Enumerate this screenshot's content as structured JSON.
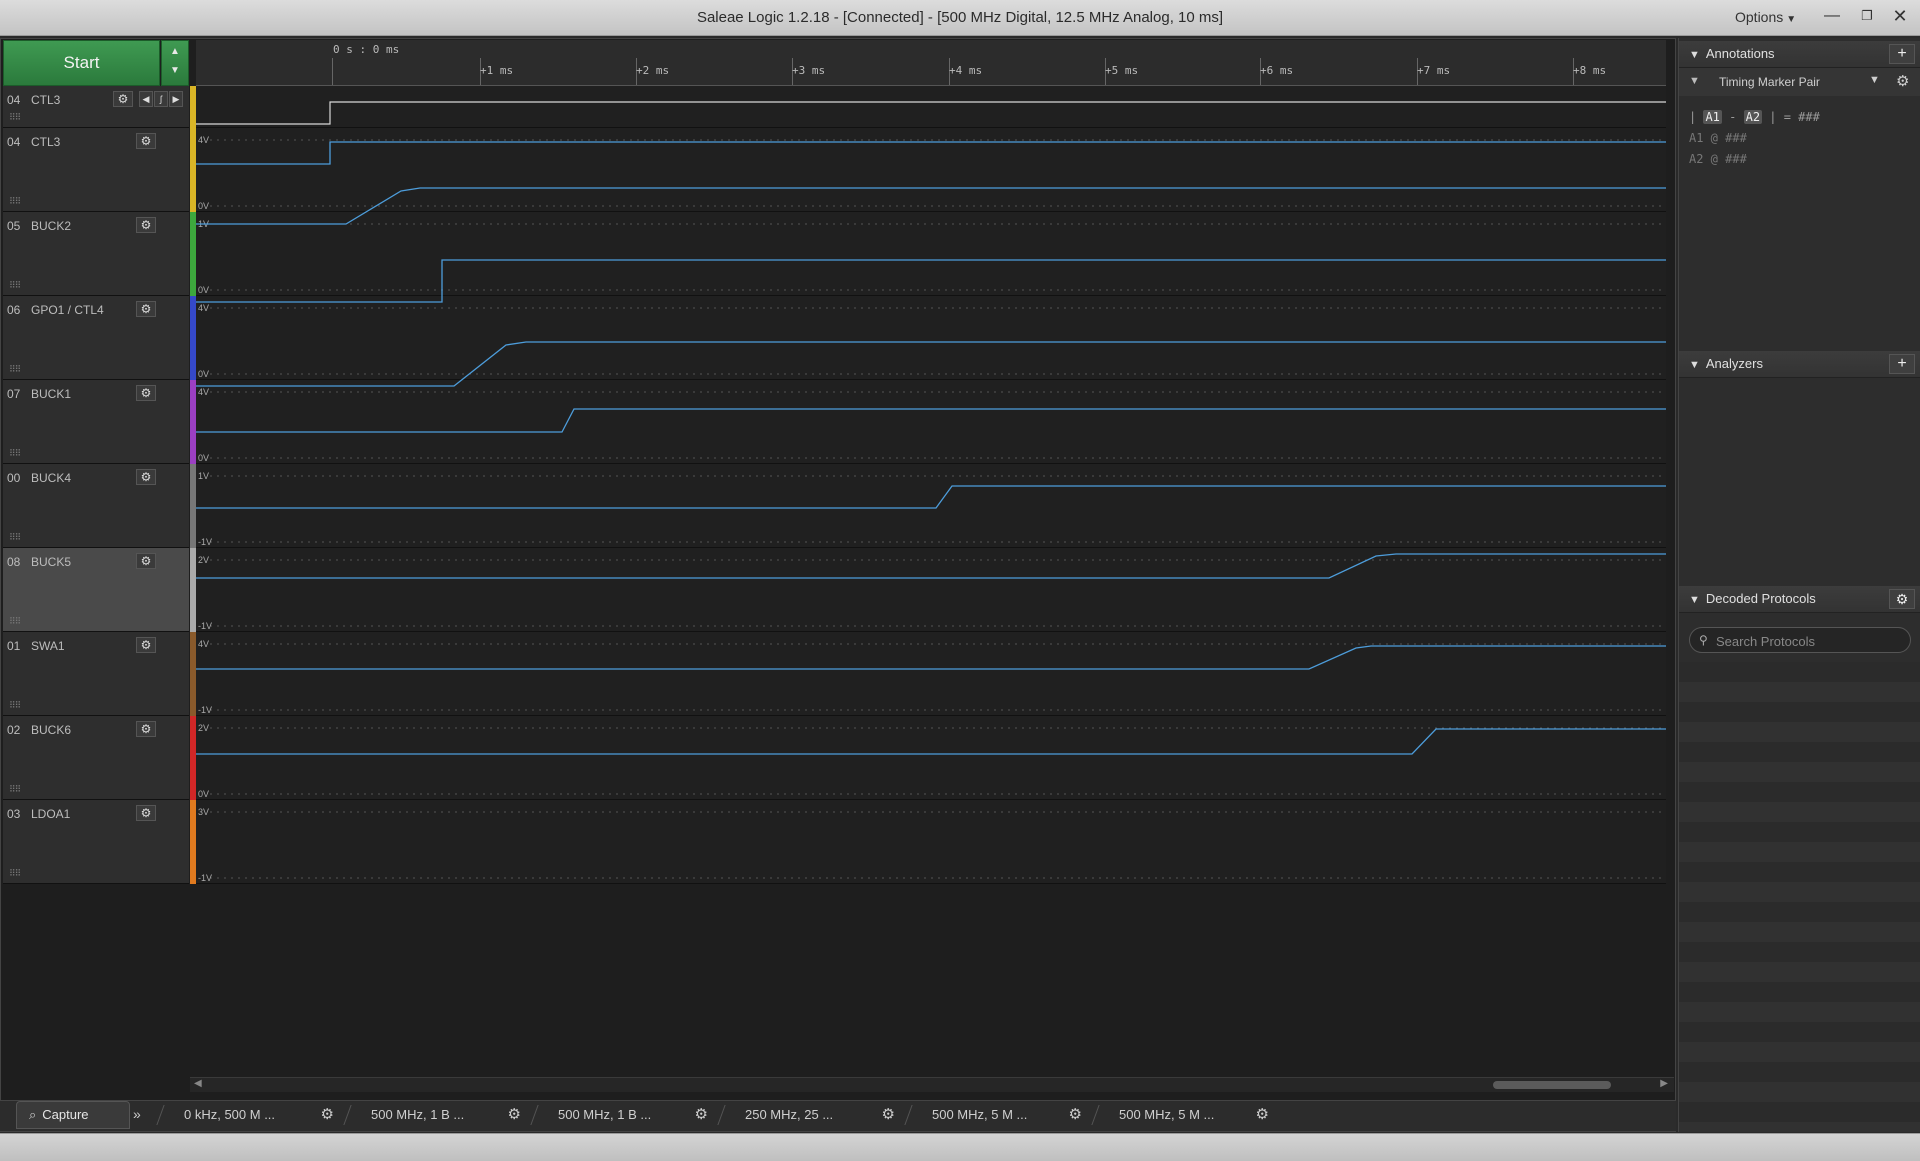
{
  "window": {
    "title": "Saleae Logic 1.2.18 - [Connected] - [500 MHz Digital, 12.5 MHz Analog, 10 ms]",
    "options_label": "Options",
    "minimize": "—",
    "maximize": "❐",
    "close": "✕"
  },
  "toolbar": {
    "start_label": "Start",
    "up_arrow": "▲",
    "down_arrow": "▼"
  },
  "ruler": {
    "origin_label": "0 s : 0 ms",
    "ticks": [
      "+1 ms",
      "+2 ms",
      "+3 ms",
      "+4 ms",
      "+5 ms",
      "+6 ms",
      "+7 ms",
      "+8 ms"
    ]
  },
  "channels": [
    {
      "num": "04",
      "name": "CTL3",
      "color": "#d9b526",
      "kind": "digital"
    },
    {
      "num": "04",
      "name": "CTL3",
      "color": "#d9b526",
      "kind": "analog",
      "vtop": "4V",
      "vbot": "0V"
    },
    {
      "num": "05",
      "name": "BUCK2",
      "color": "#3da83d",
      "kind": "analog",
      "vtop": "1V",
      "vbot": "0V"
    },
    {
      "num": "06",
      "name": "GPO1 / CTL4",
      "color": "#3549c9",
      "kind": "analog",
      "vtop": "4V",
      "vbot": "0V"
    },
    {
      "num": "07",
      "name": "BUCK1",
      "color": "#9b3fc2",
      "kind": "analog",
      "vtop": "4V",
      "vbot": "0V"
    },
    {
      "num": "00",
      "name": "BUCK4",
      "color": "#777777",
      "kind": "analog",
      "vtop": "1V",
      "vbot": "-1V"
    },
    {
      "num": "08",
      "name": "BUCK5",
      "color": "#aaaaaa",
      "kind": "analog",
      "vtop": "2V",
      "vbot": "-1V",
      "selected": true
    },
    {
      "num": "01",
      "name": "SWA1",
      "color": "#8a5a2b",
      "kind": "analog",
      "vtop": "4V",
      "vbot": "-1V"
    },
    {
      "num": "02",
      "name": "BUCK6",
      "color": "#d22727",
      "kind": "analog",
      "vtop": "2V",
      "vbot": "0V"
    },
    {
      "num": "03",
      "name": "LDOA1",
      "color": "#e07a1f",
      "kind": "analog",
      "vtop": "3V",
      "vbot": "-1V"
    }
  ],
  "trace_color": "#4d9ddb",
  "digital_trace_color": "#d8d8d8",
  "tabs": {
    "capture_label": "Capture",
    "more": "»",
    "sessions": [
      "0 kHz, 500 M ...",
      "500 MHz, 1 B ...",
      "500 MHz, 1 B ...",
      "250 MHz, 25 ...",
      "500 MHz, 5 M ...",
      "500 MHz, 5 M ..."
    ]
  },
  "panel": {
    "annotations": {
      "title": "Annotations",
      "marker_type": "Timing Marker Pair",
      "diff_prefix": "| ",
      "a1": "A1",
      "dash": " - ",
      "a2": "A2",
      "diff_suffix": " | = ###",
      "a1_line": "A1 @ ###",
      "a2_line": "A2 @ ###"
    },
    "analyzers": {
      "title": "Analyzers"
    },
    "decoded": {
      "title": "Decoded Protocols",
      "search_placeholder": "Search Protocols"
    }
  }
}
